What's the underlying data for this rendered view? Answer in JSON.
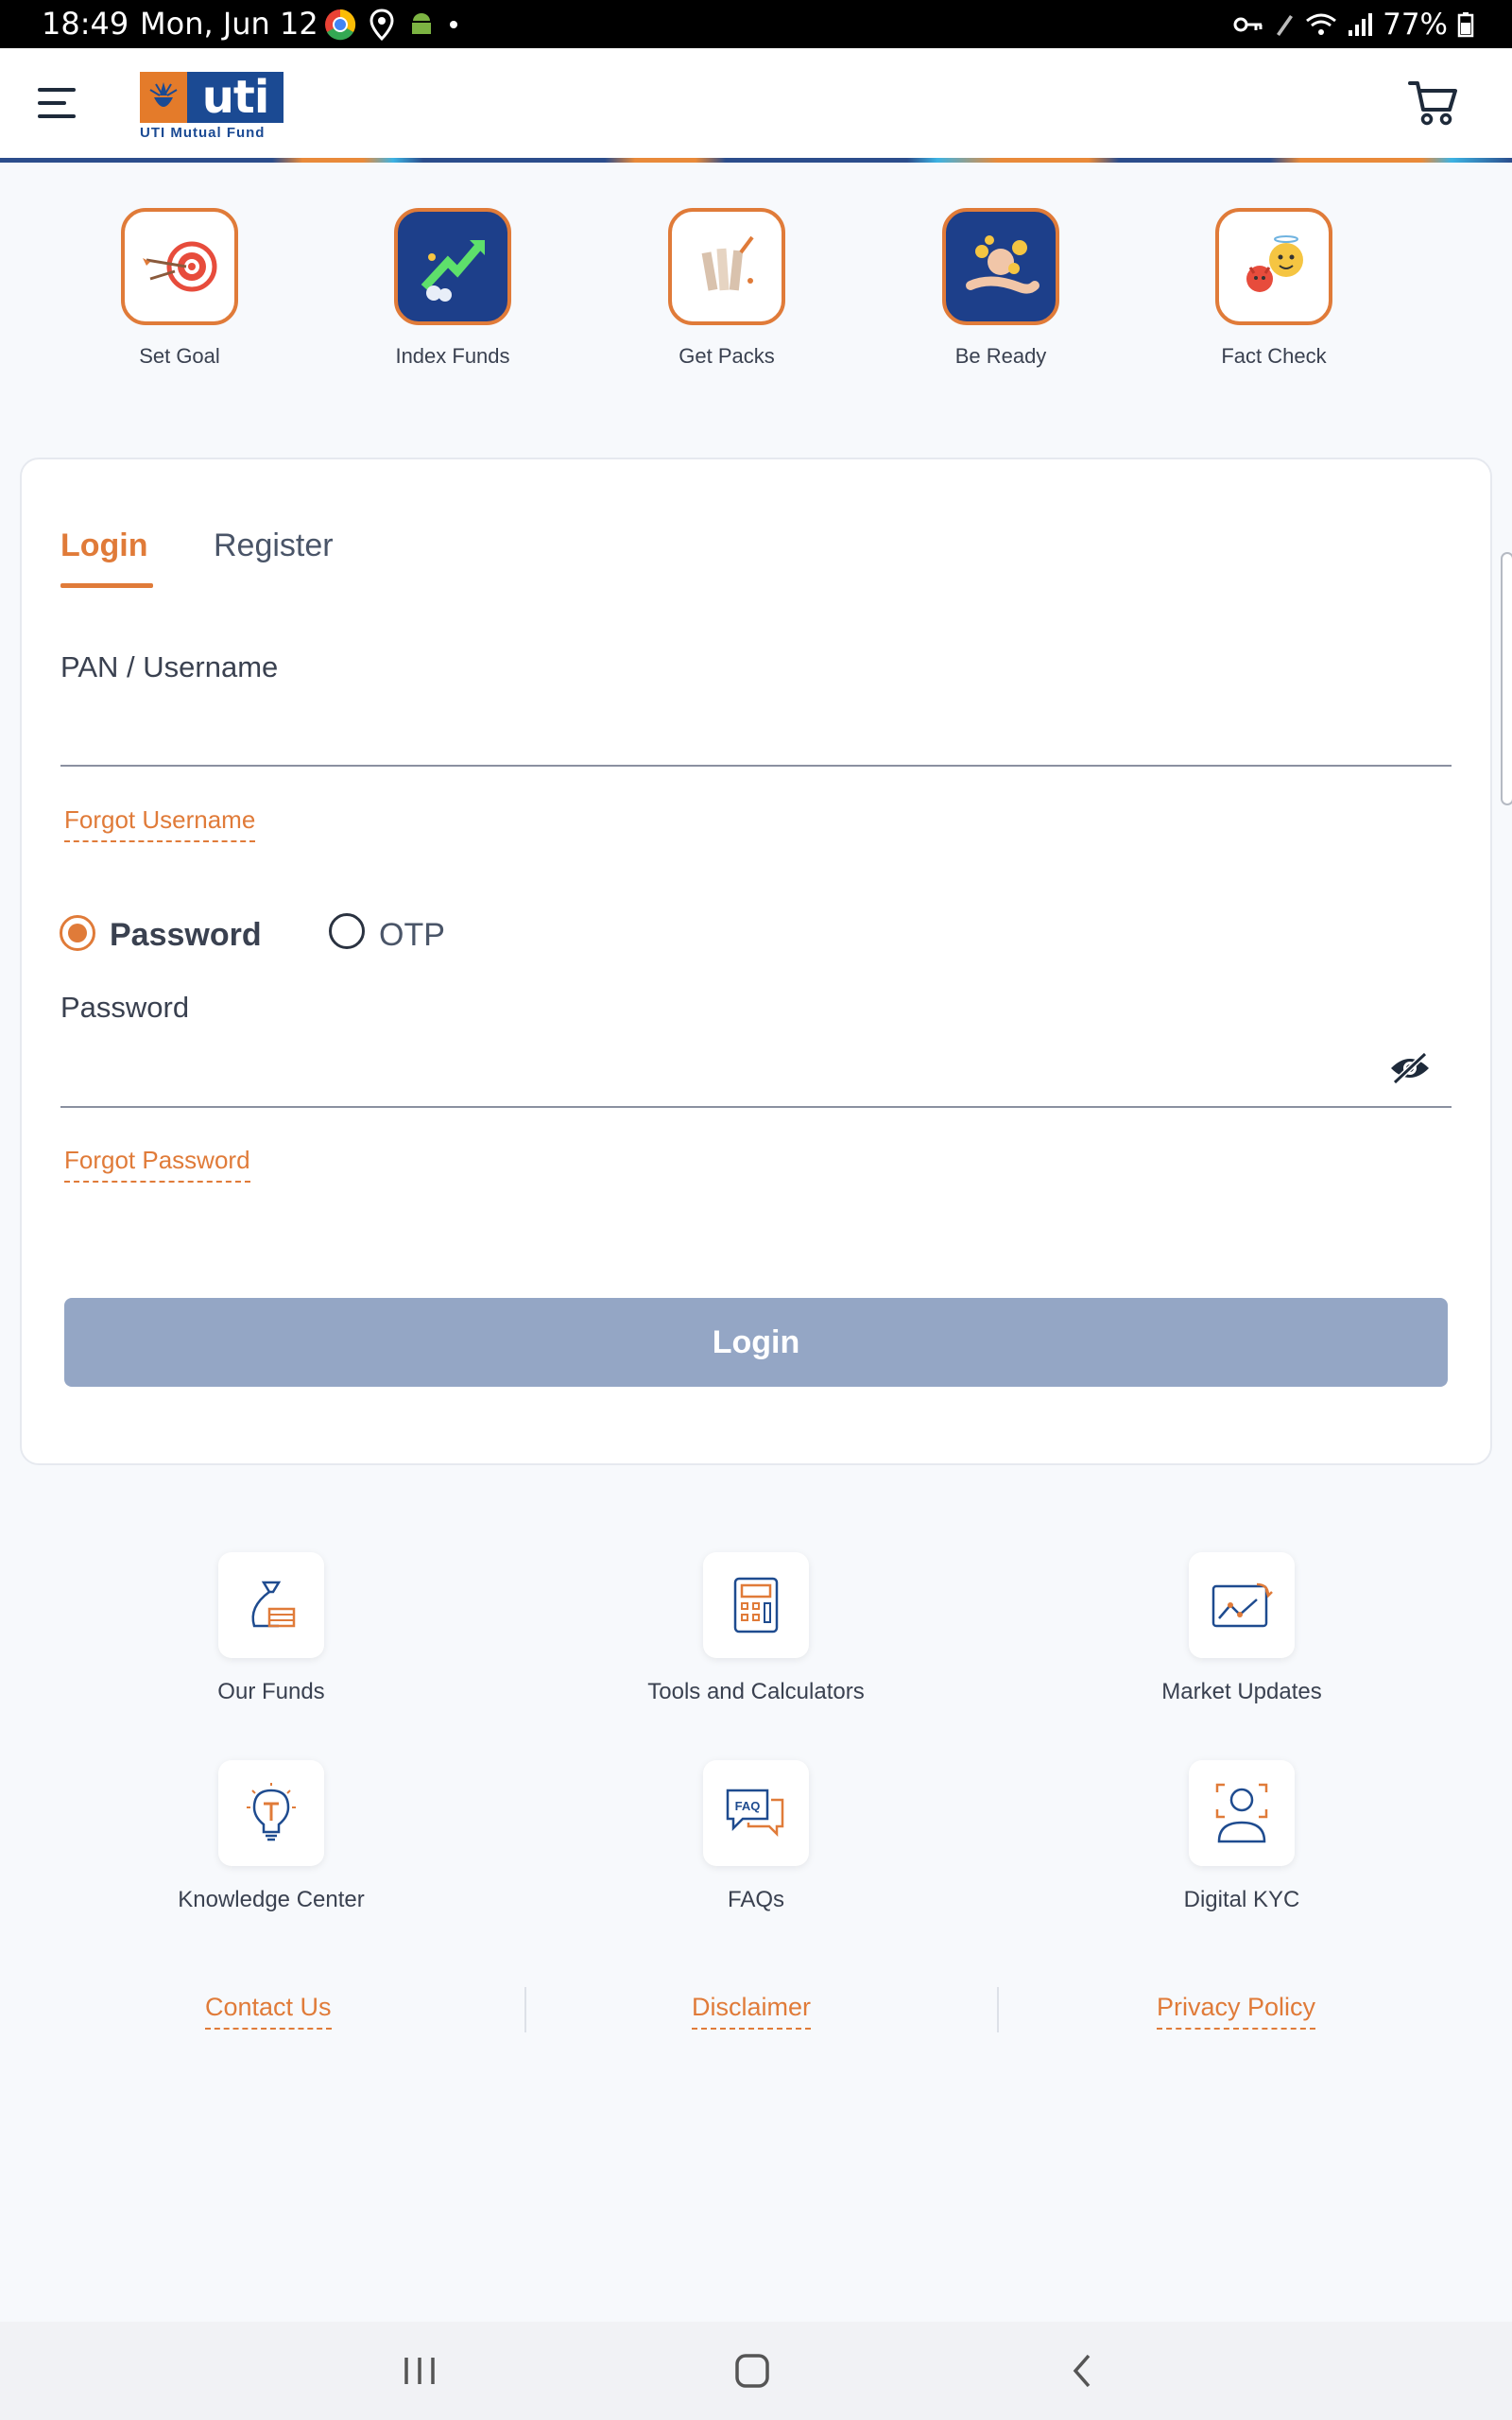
{
  "status_bar": {
    "time": "18:49",
    "date": "Mon, Jun 12",
    "battery": "77%"
  },
  "header": {
    "logo_text": "uti",
    "logo_subtitle": "UTI Mutual Fund",
    "accent_color": "#e07b39",
    "brand_color": "#1b4a93"
  },
  "categories": [
    {
      "label": "Set Goal",
      "icon": "target-dart-icon"
    },
    {
      "label": "Index Funds",
      "icon": "growth-arrow-icon"
    },
    {
      "label": "Get Packs",
      "icon": "packs-icon"
    },
    {
      "label": "Be Ready",
      "icon": "hand-coins-icon"
    },
    {
      "label": "Fact Check",
      "icon": "emoji-faces-icon"
    }
  ],
  "login_card": {
    "tabs": [
      {
        "label": "Login",
        "active": true
      },
      {
        "label": "Register",
        "active": false
      }
    ],
    "username_label": "PAN / Username",
    "username_value": "",
    "forgot_username": "Forgot Username",
    "auth_options": [
      {
        "label": "Password",
        "selected": true
      },
      {
        "label": "OTP",
        "selected": false
      }
    ],
    "password_label": "Password",
    "password_value": "",
    "forgot_password": "Forgot Password",
    "login_button": "Login"
  },
  "quick_links": [
    {
      "label": "Our Funds",
      "icon": "money-bag-icon"
    },
    {
      "label": "Tools and Calculators",
      "icon": "calculator-icon"
    },
    {
      "label": "Market Updates",
      "icon": "market-chart-icon"
    },
    {
      "label": "Knowledge Center",
      "icon": "lightbulb-icon"
    },
    {
      "label": "FAQs",
      "icon": "faq-chat-icon"
    },
    {
      "label": "Digital KYC",
      "icon": "face-scan-icon"
    }
  ],
  "footer_links": [
    "Contact Us",
    "Disclaimer",
    "Privacy Policy"
  ]
}
